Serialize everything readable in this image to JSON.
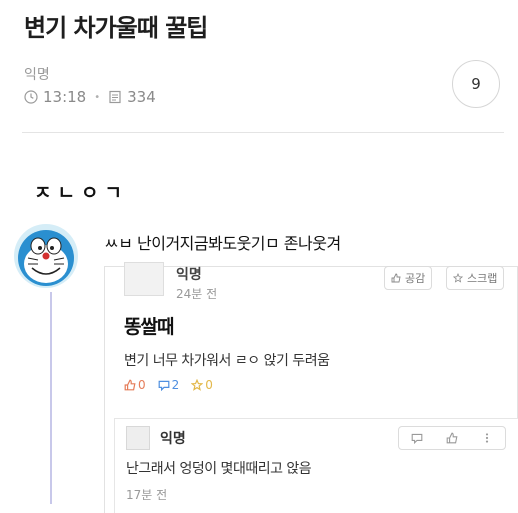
{
  "post": {
    "title": "변기 차가울때 꿀팁",
    "author": "익명",
    "time": "13:18",
    "views": "334",
    "comment_count": "9"
  },
  "body_text": "ㅈㄴㅇㄱ",
  "comment": {
    "text": "ㅆㅂ 난이거지금봐도웃기ㅁ 존나웃겨"
  },
  "quoted_post": {
    "author_partial": "익명",
    "time": "24분 전",
    "buttons": {
      "like": "공감",
      "scrap": "스크랩"
    },
    "title": "똥쌀때",
    "body": "변기 너무 차가워서 ㄹㅇ 앉기 두려움",
    "reactions": {
      "likes": "0",
      "comments": "2",
      "scraps": "0"
    },
    "reply": {
      "author": "익명",
      "body": "난그래서 엉덩이 몇대때리고 앉음",
      "time": "17분 전"
    }
  },
  "colors": {
    "like": "#e57c59",
    "comment": "#4f8fe0",
    "scrap": "#e3b84a",
    "thread_line": "#c8c8ea"
  },
  "icons": [
    "clock-icon",
    "document-icon",
    "thumbs-up-icon",
    "speech-bubble-icon",
    "star-icon",
    "more-icon"
  ]
}
